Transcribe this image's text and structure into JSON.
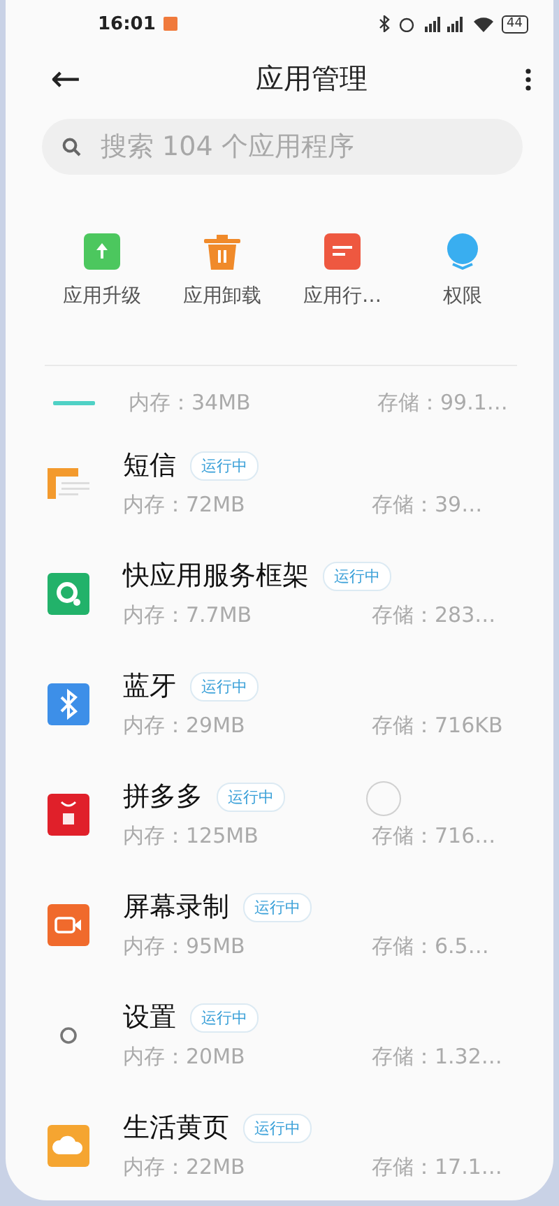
{
  "status_bar": {
    "time": "16:01",
    "battery": "44"
  },
  "header": {
    "title": "应用管理",
    "back": "←"
  },
  "search": {
    "placeholder": "搜索 104 个应用程序"
  },
  "shortcuts": [
    {
      "kind": "upgrade",
      "label": "应用升级"
    },
    {
      "kind": "uninstall",
      "label": "应用卸载"
    },
    {
      "kind": "behavior",
      "label": "应用行…"
    },
    {
      "kind": "permission",
      "label": "权限"
    }
  ],
  "partial_row": {
    "memory": "内存：34MB",
    "storage": "存储：99.1…"
  },
  "apps": [
    {
      "kind": "sms",
      "name": "短信",
      "badge": "运行中",
      "memory": "内存：72MB",
      "storage": "存储：39…"
    },
    {
      "kind": "quickapp",
      "name": "快应用服务框架",
      "badge": "运行中",
      "memory": "内存：7.7MB",
      "storage": "存储：283…"
    },
    {
      "kind": "bluetooth",
      "name": "蓝牙",
      "badge": "运行中",
      "memory": "内存：29MB",
      "storage": "存储：716KB"
    },
    {
      "kind": "pdd",
      "name": "拼多多",
      "badge": "运行中",
      "memory": "内存：125MB",
      "storage": "存储：716…"
    },
    {
      "kind": "recorder",
      "name": "屏幕录制",
      "badge": "运行中",
      "memory": "内存：95MB",
      "storage": "存储：6.5…"
    },
    {
      "kind": "settings",
      "name": "设置",
      "badge": "运行中",
      "memory": "内存：20MB",
      "storage": "存储：1.32…"
    },
    {
      "kind": "yellowpages",
      "name": "生活黄页",
      "badge": "运行中",
      "memory": "内存：22MB",
      "storage": "存储：17.1…"
    }
  ]
}
